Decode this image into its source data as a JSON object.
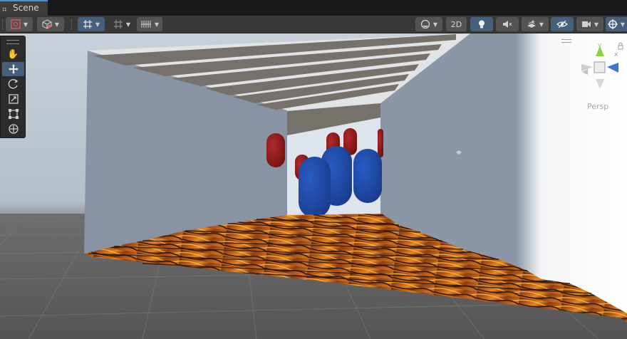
{
  "tab": {
    "label": "Scene"
  },
  "toolbar": {
    "mode_2d": "2D",
    "icons": [
      "gizmo-draw-mode-icon",
      "shaded-cube-icon",
      "grid-snap-icon",
      "increment-snap-icon",
      "grid-icon",
      "shading-sphere-icon",
      "lighting-icon",
      "audio-mute-icon",
      "effects-icon",
      "hidden-visibility-icon",
      "camera-icon",
      "gizmos-icon"
    ]
  },
  "tools": [
    "view-tool",
    "move-tool",
    "rotate-tool",
    "scale-tool",
    "rect-tool",
    "transform-tool"
  ],
  "active_tool": "move-tool",
  "view": {
    "projection": "Persp"
  },
  "axis_labels": {
    "y": "y",
    "x": "x"
  },
  "colors": {
    "sky": "#b7c2cd",
    "ground": "#5b5b5b",
    "wall": "#8a96a5",
    "ceiling_beam": "#76716c",
    "red_capsule": "#8e1717",
    "blue_capsule": "#1c48a8",
    "lava": "#c1521a",
    "accent": "#46607c"
  }
}
